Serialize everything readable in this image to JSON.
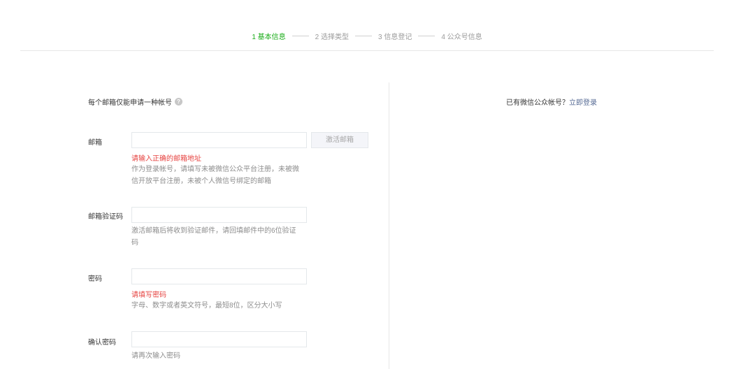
{
  "steps": [
    {
      "label": "1 基本信息",
      "active": true
    },
    {
      "label": "2 选择类型",
      "active": false
    },
    {
      "label": "3 信息登记",
      "active": false
    },
    {
      "label": "4 公众号信息",
      "active": false
    }
  ],
  "form": {
    "tip": "每个邮箱仅能申请一种帐号",
    "email": {
      "label": "邮箱",
      "value": "",
      "activate_button": "激活邮箱",
      "error": "请输入正确的邮箱地址",
      "hint": "作为登录帐号，请填写未被微信公众平台注册，未被微信开放平台注册，未被个人微信号绑定的邮箱"
    },
    "code": {
      "label": "邮箱验证码",
      "value": "",
      "hint": "激活邮箱后将收到验证邮件，请回填邮件中的6位验证码"
    },
    "password": {
      "label": "密码",
      "value": "",
      "error": "请填写密码",
      "hint": "字母、数字或者英文符号，最短8位，区分大小写"
    },
    "confirm": {
      "label": "确认密码",
      "value": "",
      "hint": "请再次输入密码"
    }
  },
  "side": {
    "text": "已有微信公众帐号？",
    "link": "立即登录"
  },
  "colors": {
    "active_step": "#1aad19",
    "error": "#e64340",
    "link": "#576b95"
  }
}
